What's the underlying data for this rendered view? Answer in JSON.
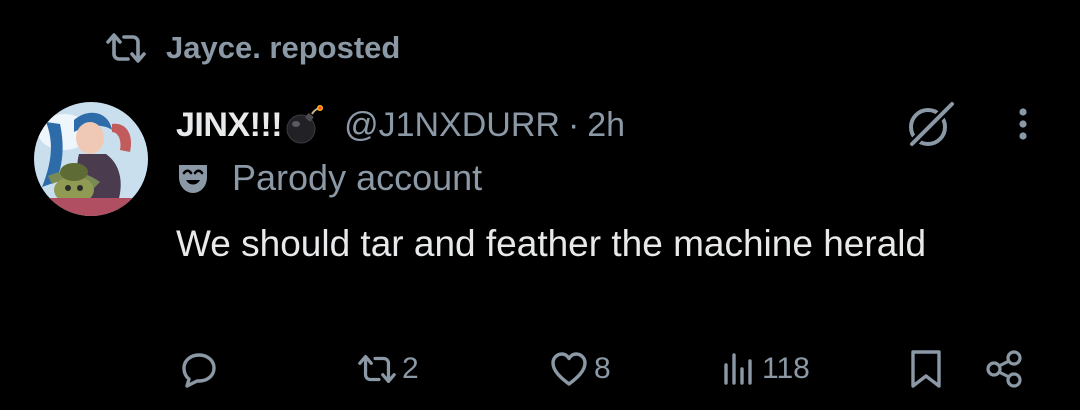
{
  "repost": {
    "icon": "repost-icon",
    "text": "Jayce. reposted"
  },
  "post": {
    "avatar": "jinx-avatar",
    "author": {
      "display_name": "JINX!!!",
      "emoji": "bomb-emoji",
      "handle": "@J1NXDURR",
      "separator": "·",
      "time": "2h"
    },
    "label": {
      "icon": "parody-mask-icon",
      "text": "Parody account"
    },
    "text": "We should tar and feather the machine herald",
    "actions": {
      "reply": {
        "icon": "reply-icon",
        "count": ""
      },
      "repost": {
        "icon": "repost-icon",
        "count": "2"
      },
      "like": {
        "icon": "heart-icon",
        "count": "8"
      },
      "views": {
        "icon": "views-icon",
        "count": "118"
      },
      "bookmark": {
        "icon": "bookmark-icon"
      },
      "share": {
        "icon": "share-icon"
      }
    }
  },
  "colors": {
    "background": "#000000",
    "primary_text": "#e7e9ea",
    "secondary_text": "#8b98a5"
  }
}
